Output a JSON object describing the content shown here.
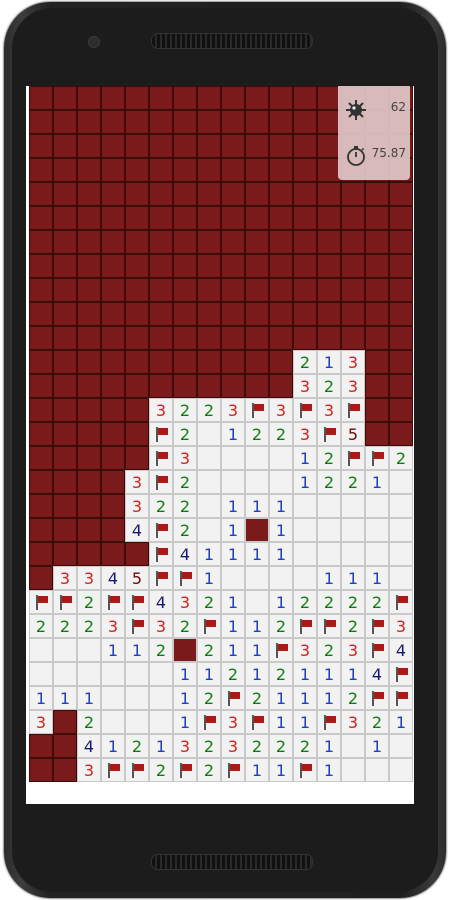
{
  "colors": {
    "hidden": "#7a1a1a",
    "open": "#f2f2f2",
    "flag": "#b01818",
    "n1": "#1f3fbf",
    "n2": "#157a15",
    "n3": "#d0201c",
    "n4": "#1a1a6e",
    "n5": "#6a0a0a"
  },
  "hud": {
    "mine_icon": "mine-icon",
    "mines_remaining": "62",
    "timer_icon": "stopwatch-icon",
    "elapsed_time": "75.87"
  },
  "board": {
    "columns": 16,
    "rows": 30,
    "legend": "#=hidden . =empty F=flag M=revealed mine 1-8=number",
    "grid": [
      "################",
      "################",
      "################",
      "################",
      "################",
      "################",
      "################",
      "################",
      "################",
      "################",
      "################",
      "###########213##",
      "###########323##",
      "#####3223F3F3F##",
      "#####F2.1223F5##",
      "#####F3....12FF2",
      "####3F2....1221.",
      "####322.111.....",
      "####4F2.1M1.....",
      "#####F41111.....",
      "#3345FF1....111.",
      "FF2FF4321.12222F2",
      "2223F32F112FF2F33F",
      "...112M211F323F4",
      "......112121114FF",
      "111...12F21112FF#",
      "3#2...1F3F11F321",
      "##41213232221 1..",
      "##3FF2F2F11F1...."
    ]
  }
}
